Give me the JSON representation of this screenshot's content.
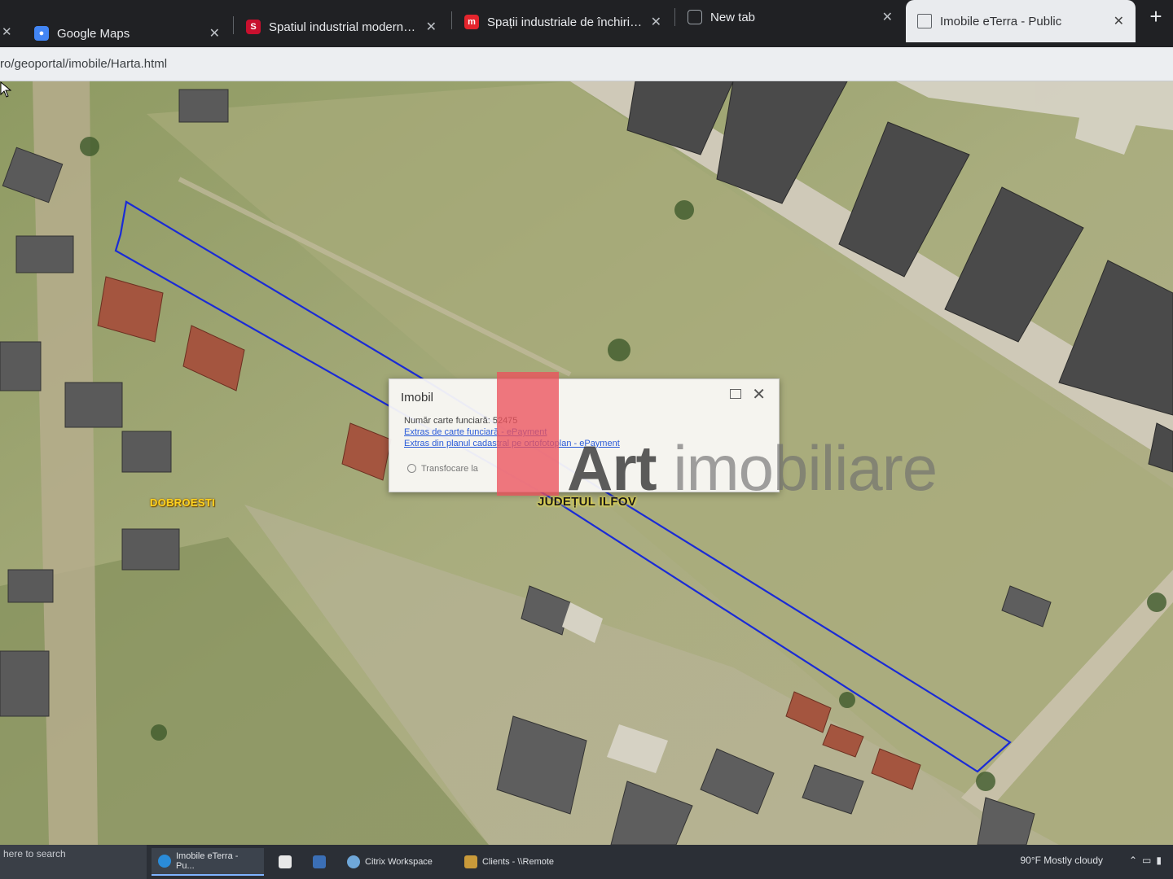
{
  "browser": {
    "tabs": [
      {
        "label": "Google Maps",
        "icon": "google-maps-icon",
        "icon_color": "#4285f4",
        "active": false
      },
      {
        "label": "Spatiul industrial modern Stefan",
        "icon": "storia-icon",
        "icon_color": "#c8102e",
        "active": false
      },
      {
        "label": "Spații industriale de închiriat în B",
        "icon": "imobiliare-icon",
        "icon_color": "#e4252d",
        "active": false
      },
      {
        "label": "New tab",
        "icon": "new-tab-icon",
        "icon_color": "#9aa0a6",
        "active": false
      },
      {
        "label": "Imobile eTerra - Public",
        "icon": "document-icon",
        "icon_color": "#5f6368",
        "active": true
      }
    ],
    "new_tab_symbol": "+",
    "close_symbol": "✕",
    "url": "ro/geoportal/imobile/Harta.html"
  },
  "map": {
    "labels": {
      "locality": "DOBROESTI",
      "county": "JUDEȚUL ILFOV"
    },
    "parcel_outline_color": "#1a2bd6"
  },
  "popup": {
    "title": "Imobil",
    "cadastral_label": "Număr carte funciară:",
    "cadastral_number": "52475",
    "link_extract": "Extras de carte funciară - ePayment",
    "link_cadastral_plan": "Extras din planul cadastral pe ortofotoplan - ePayment",
    "zoom_action": "Transfocare la"
  },
  "watermark": {
    "brand_bold": "Art",
    "brand_light": "imobiliare",
    "accent_color": "#ec525c"
  },
  "taskbar": {
    "search_placeholder": "here to search",
    "items": [
      {
        "label": "Imobile eTerra - Pu...",
        "icon": "edge-icon",
        "active": true
      },
      {
        "label": "",
        "icon": "file-icon",
        "active": false
      },
      {
        "label": "",
        "icon": "calculator-icon",
        "active": false
      },
      {
        "label": "Citrix Workspace",
        "icon": "citrix-icon",
        "active": false
      },
      {
        "label": "Clients - \\\\Remote",
        "icon": "folder-icon",
        "active": false
      }
    ],
    "weather": "90°F  Mostly cloudy"
  }
}
